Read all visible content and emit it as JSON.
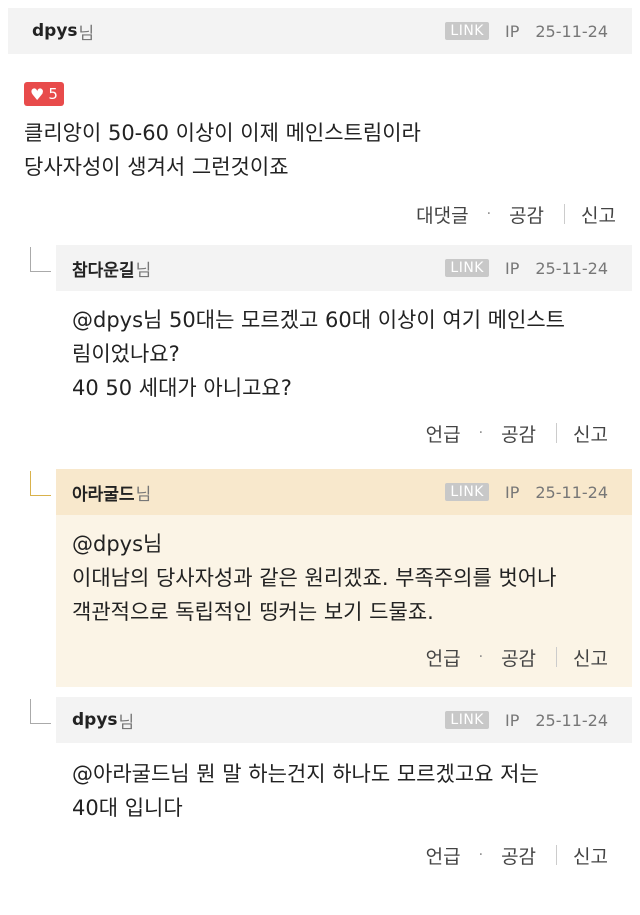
{
  "comments": [
    {
      "nick": "dpys",
      "nim": "님",
      "link": "LINK",
      "ip": "IP",
      "date": "25-11-24",
      "likes": "5",
      "lines": [
        "클리앙이 50-60 이상이 이제 메인스트림이라",
        "당사자성이 생겨서 그런것이죠"
      ],
      "action1": "대댓글",
      "action2": "공감",
      "action3": "신고"
    },
    {
      "nick": "참다운길",
      "nim": "님",
      "link": "LINK",
      "ip": "IP",
      "date": "25-11-24",
      "lines": [
        "@dpys님 50대는 모르겠고 60대 이상이 여기 메인스트",
        "림이었나요?",
        "40 50 세대가 아니고요?"
      ],
      "action1": "언급",
      "action2": "공감",
      "action3": "신고"
    },
    {
      "nick": "아라굴드",
      "nim": "님",
      "link": "LINK",
      "ip": "IP",
      "date": "25-11-24",
      "lines": [
        "@dpys님",
        "이대남의 당사자성과 같은 원리겠죠. 부족주의를 벗어나",
        "객관적으로 독립적인 띵커는 보기 드물죠."
      ],
      "action1": "언급",
      "action2": "공감",
      "action3": "신고"
    },
    {
      "nick": "dpys",
      "nim": "님",
      "link": "LINK",
      "ip": "IP",
      "date": "25-11-24",
      "lines": [
        "@아라굴드님 뭔 말 하는건지 하나도 모르겠고요 저는",
        "40대 입니다"
      ],
      "action1": "언급",
      "action2": "공감",
      "action3": "신고"
    }
  ],
  "dot": "·",
  "heart_icon": "♥"
}
